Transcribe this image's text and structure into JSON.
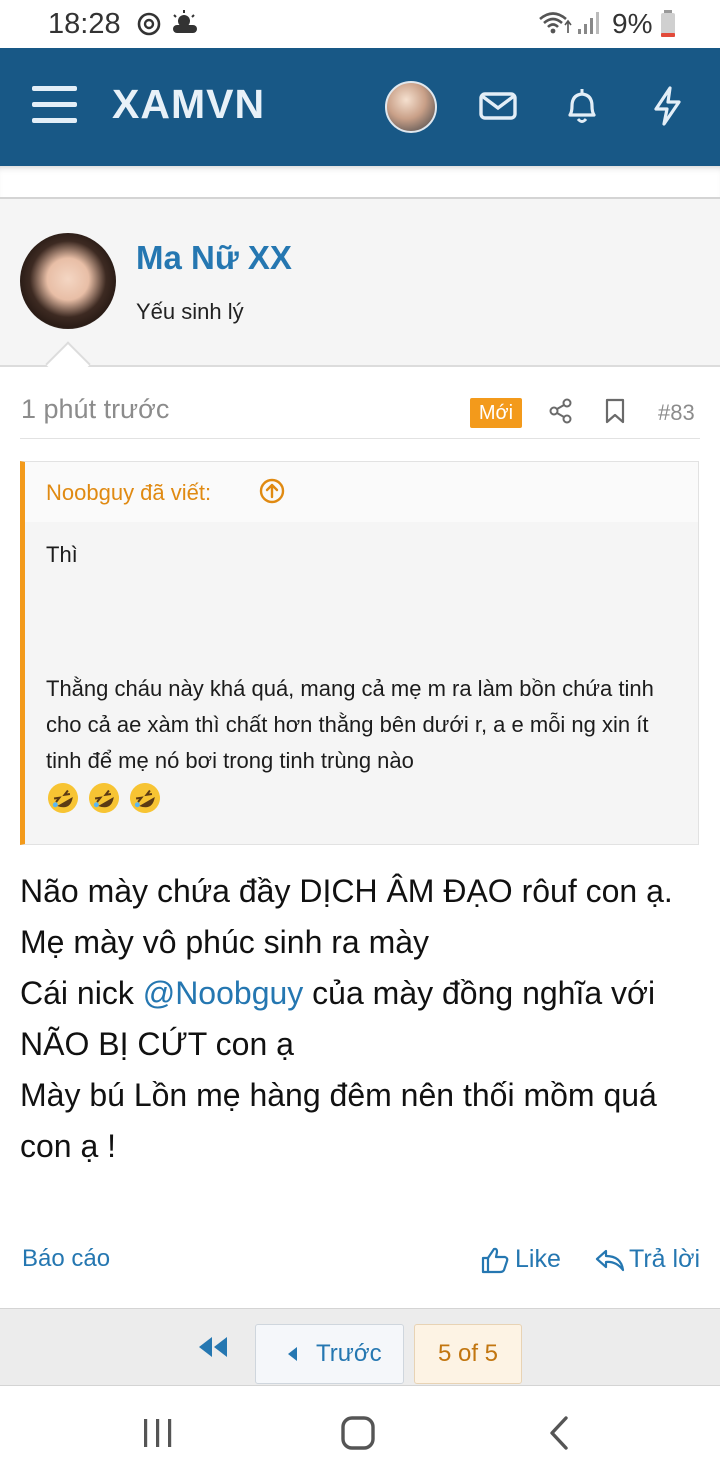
{
  "status_bar": {
    "time": "18:28",
    "battery": "9%"
  },
  "header": {
    "brand": "XAMVN",
    "color": "#185886"
  },
  "post": {
    "author_name": "Ma Nữ XX",
    "author_title": "Yếu sinh lý",
    "time": "1 phút trước",
    "new_badge": "Mới",
    "number": "#83",
    "quote": {
      "author": "Noobguy đã viết:",
      "line1": "Thì",
      "line2": "Thằng cháu này khá quá, mang cả mẹ m ra làm bồn chứa tinh cho cả ae xàm thì chất hơn thằng bên dưới r, a e mỗi ng xin ít tinh để mẹ nó bơi trong tinh trùng nào"
    },
    "body": {
      "p1": "Não mày chứa đầy DỊCH ÂM ĐẠO rôuf con ạ.",
      "p2": "Mẹ mày vô phúc sinh ra mày",
      "p3_before": "Cái nick ",
      "mention": "@Noobguy",
      "p3_after": " của mày đồng nghĩa với NÃO BỊ CỨT con ạ",
      "p4": "Mày bú Lồn mẹ hàng đêm nên thối mồm quá con ạ !"
    },
    "actions": {
      "report": "Báo cáo",
      "like": "Like",
      "reply": "Trả lời"
    }
  },
  "pagination": {
    "prev": "Trước",
    "info": "5 of 5"
  },
  "accent_color": "#f39a1b",
  "link_color": "#2577b1"
}
